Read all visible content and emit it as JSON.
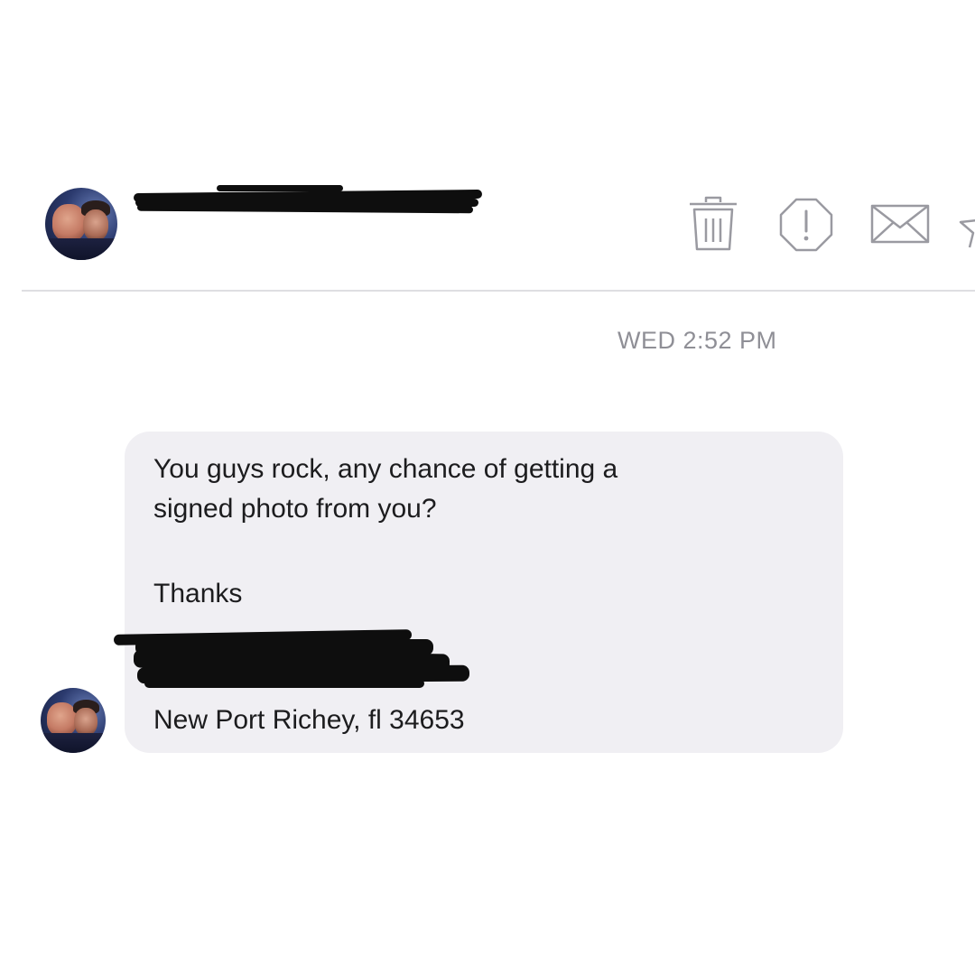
{
  "header": {
    "contact_name_redacted": true,
    "actions": [
      {
        "icon": "trash-icon",
        "label": "Delete"
      },
      {
        "icon": "report-icon",
        "label": "Report"
      },
      {
        "icon": "mail-icon",
        "label": "Mark unread"
      },
      {
        "icon": "star-icon",
        "label": "Favorite"
      }
    ]
  },
  "conversation": {
    "timestamp": "WED 2:52 PM",
    "message": {
      "line1": "You guys rock, any chance of getting a",
      "line2": "signed photo from you?",
      "line3": "Thanks",
      "address": "New Port Richey, fl 34653"
    }
  },
  "colors": {
    "bubble_bg": "#f0eff3",
    "timestamp": "#8f8f96",
    "divider": "#dedee2",
    "icon_stroke": "#9a9aa1"
  }
}
